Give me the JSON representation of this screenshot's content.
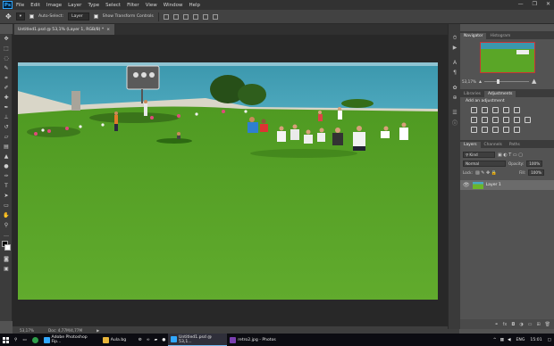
{
  "menubar": {
    "logo": "Ps",
    "items": [
      "File",
      "Edit",
      "Image",
      "Layer",
      "Type",
      "Select",
      "Filter",
      "View",
      "Window",
      "Help"
    ],
    "window_controls": [
      "—",
      "❐",
      "✕"
    ]
  },
  "options": {
    "auto_select_label": "Auto-Select:",
    "auto_select_value": "Layer",
    "show_transform_label": "Show Transform Controls"
  },
  "document": {
    "tab_title": "Untitled1.psd @ 53,1% (Layer 1, RGB/8) *",
    "tab_close": "×",
    "status_zoom": "53,17%",
    "status_doc": "Doc: 4,77M/4,77M",
    "status_arrow": "▶"
  },
  "navigator": {
    "tabs": [
      "Navigator",
      "Histogram"
    ],
    "zoom": "53,17%"
  },
  "adjustments": {
    "tabs": [
      "Libraries",
      "Adjustments"
    ],
    "add_label": "Add an adjustment"
  },
  "layers": {
    "tabs": [
      "Layers",
      "Channels",
      "Paths"
    ],
    "kind": "Kind",
    "blend_mode": "Normal",
    "opacity_label": "Opacity:",
    "opacity_value": "100%",
    "lock_label": "Lock:",
    "fill_label": "Fill:",
    "fill_value": "100%",
    "layer_name": "Layer 1"
  },
  "taskbar": {
    "search_icon": "search-icon",
    "apps": [
      {
        "label": "Adobe Photoshop Fip...",
        "color": "#31a8ff"
      },
      {
        "label": "Aula.bg",
        "color": "#e8b53a"
      },
      {
        "label": "Untitled1.psd @ 53,1...",
        "color": "#31a8ff"
      },
      {
        "label": "retro2.jpg - Photos",
        "color": "#7a3fb0"
      }
    ],
    "lang": "ENG",
    "time": "15:01"
  },
  "colors": {
    "accent": "#31a8ff",
    "grass": "#5aa627",
    "sea": "#3e9db4"
  }
}
